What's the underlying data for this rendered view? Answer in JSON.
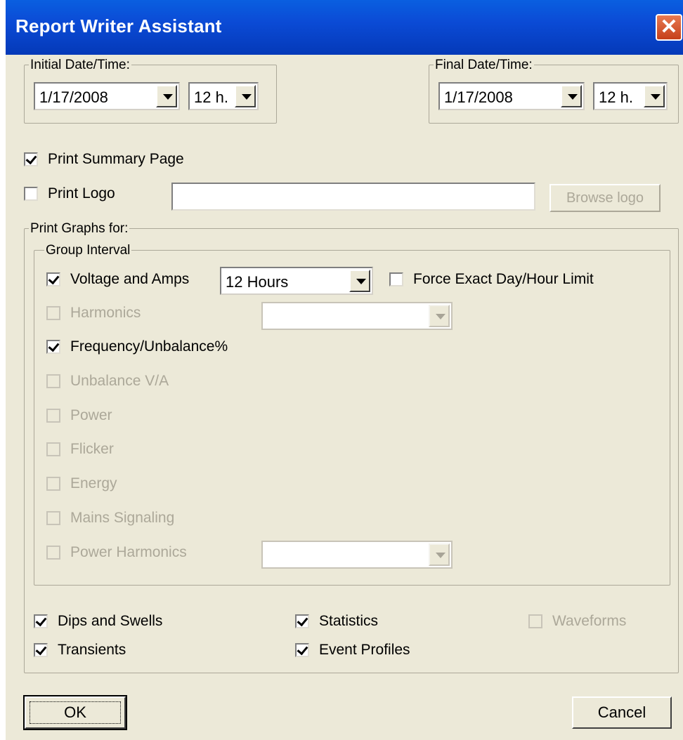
{
  "window": {
    "title": "Report Writer Assistant",
    "close_glyph": "✕"
  },
  "initial": {
    "legend": "Initial Date/Time:",
    "date": "1/17/2008",
    "hour": "12 h."
  },
  "final": {
    "legend": "Final Date/Time:",
    "date": "1/17/2008",
    "hour": "12 h."
  },
  "summary": {
    "label": "Print Summary Page",
    "checked": true
  },
  "logo": {
    "label": "Print Logo",
    "checked": false,
    "path_value": "",
    "browse_label": "Browse logo"
  },
  "graphs": {
    "legend": "Print Graphs for:",
    "group_interval_legend": "Group Interval",
    "voltage": {
      "label": "Voltage and Amps",
      "checked": true,
      "interval": "12 Hours"
    },
    "force_exact": {
      "label": "Force Exact Day/Hour Limit",
      "checked": false
    },
    "items": [
      {
        "label": "Harmonics",
        "checked": false,
        "enabled": false
      },
      {
        "label": "Frequency/Unbalance%",
        "checked": true,
        "enabled": true
      },
      {
        "label": "Unbalance V/A",
        "checked": false,
        "enabled": false
      },
      {
        "label": "Power",
        "checked": false,
        "enabled": false
      },
      {
        "label": "Flicker",
        "checked": false,
        "enabled": false
      },
      {
        "label": "Energy",
        "checked": false,
        "enabled": false
      },
      {
        "label": "Mains Signaling",
        "checked": false,
        "enabled": false
      },
      {
        "label": "Power Harmonics",
        "checked": false,
        "enabled": false
      }
    ],
    "harmonics_select_value": "",
    "power_harmonics_select_value": "",
    "extras": [
      {
        "label": "Dips and Swells",
        "checked": true,
        "enabled": true
      },
      {
        "label": "Statistics",
        "checked": true,
        "enabled": true
      },
      {
        "label": "Waveforms",
        "checked": false,
        "enabled": false
      },
      {
        "label": "Transients",
        "checked": true,
        "enabled": true
      },
      {
        "label": "Event Profiles",
        "checked": true,
        "enabled": true
      }
    ]
  },
  "buttons": {
    "ok": "OK",
    "cancel": "Cancel"
  }
}
